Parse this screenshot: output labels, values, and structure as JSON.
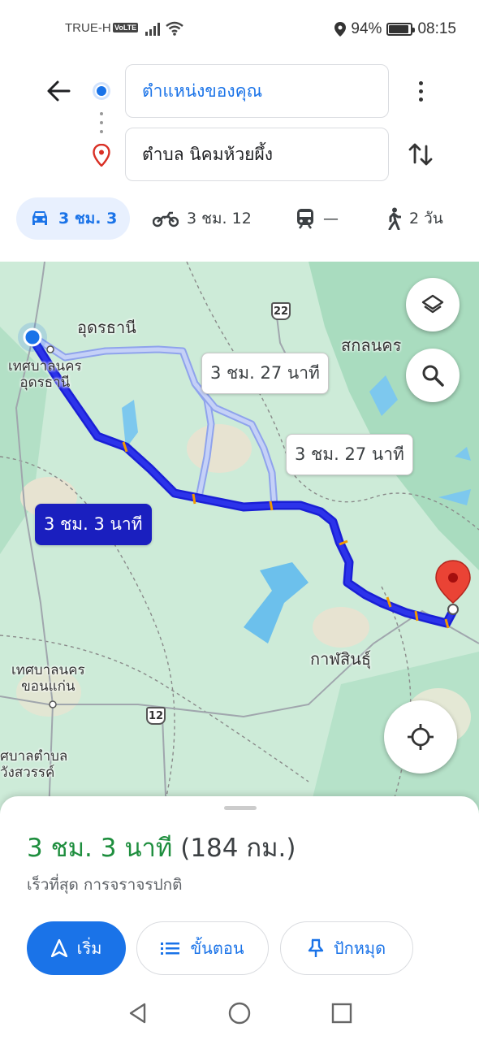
{
  "status_bar": {
    "carrier": "TRUE-H",
    "volte": "VoLTE",
    "battery": "94%",
    "time": "08:15"
  },
  "search": {
    "origin": "ตำแหน่งของคุณ",
    "destination": "ตำบล นิคมห้วยผึ้ง"
  },
  "modes": [
    {
      "icon": "car-icon",
      "label": "3 ชม. 3",
      "active": true
    },
    {
      "icon": "motorcycle-icon",
      "label": "3 ชม. 12",
      "active": false
    },
    {
      "icon": "train-icon",
      "label": "—",
      "active": false
    },
    {
      "icon": "walk-icon",
      "label": "2 วัน",
      "active": false
    }
  ],
  "map": {
    "labels": {
      "udon": "อุดรธานี",
      "udon_muni": "เทศบาลนคร\nอุดรธานี",
      "sakon": "สกลนคร",
      "kalasin": "กาฬสินธุ์",
      "khonkaen": "เทศบาลนคร\nขอนแก่น",
      "wangsawan": "ศบาลตำบล\nวังสวรรค์"
    },
    "shields": {
      "r22": "22",
      "r12": "12"
    },
    "route_bubbles": {
      "primary": "3 ชม. 3 นาที",
      "alt1": "3 ชม. 27 นาที",
      "alt2": "3 ชม. 27 นาที"
    },
    "colors": {
      "route": "#1a1fd6",
      "alt_route": "#a6b7f0",
      "pin": "#ea4335"
    }
  },
  "sheet": {
    "duration": "3 ชม. 3 นาที",
    "distance": "(184 กม.)",
    "subtitle": "เร็วที่สุด การจราจรปกติ",
    "buttons": {
      "start": "เริ่ม",
      "steps": "ขั้นตอน",
      "pin": "ปักหมุด"
    }
  }
}
